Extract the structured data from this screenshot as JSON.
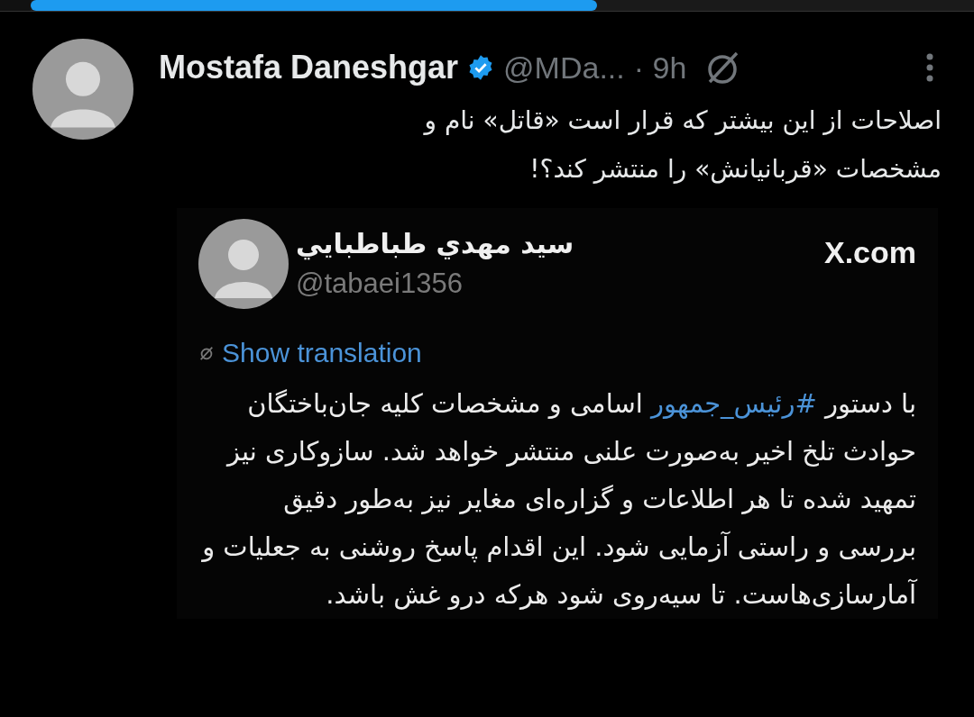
{
  "progress": {
    "level": 0.6
  },
  "tweet": {
    "author": "Mostafa Daneshgar",
    "verified": true,
    "handle": "@MDa...",
    "time": "· 9h",
    "text_lines": [
      "اصلاحات از این بیشتر که قرار است «قاتل» نام و",
      "مشخصات «قربانیانش» را منتشر کند؟!"
    ]
  },
  "quoted": {
    "name": "سید مهدي طباطبايي",
    "handle": "@tabaei1356",
    "site": "X.com",
    "translate": "Show translation",
    "body_before": "با دستور ",
    "hashtag": "#رئیس_جمهور",
    "body_after": " اسامی و مشخصات کلیه جان‌باختگان حوادث تلخ اخیر  به‌صورت علنی منتشر خواهد شد. سازوکاری نیز تمهید شده تا هر اطلاعات و گزاره‌ای مغایر نیز به‌طور دقیق بررسی و راستی آزمایی شود. این اقدام پاسخ روشنی به جعلیات و آمارسازی‌هاست. تا سیه‌روی شود هرکه درو غش باشد."
  }
}
